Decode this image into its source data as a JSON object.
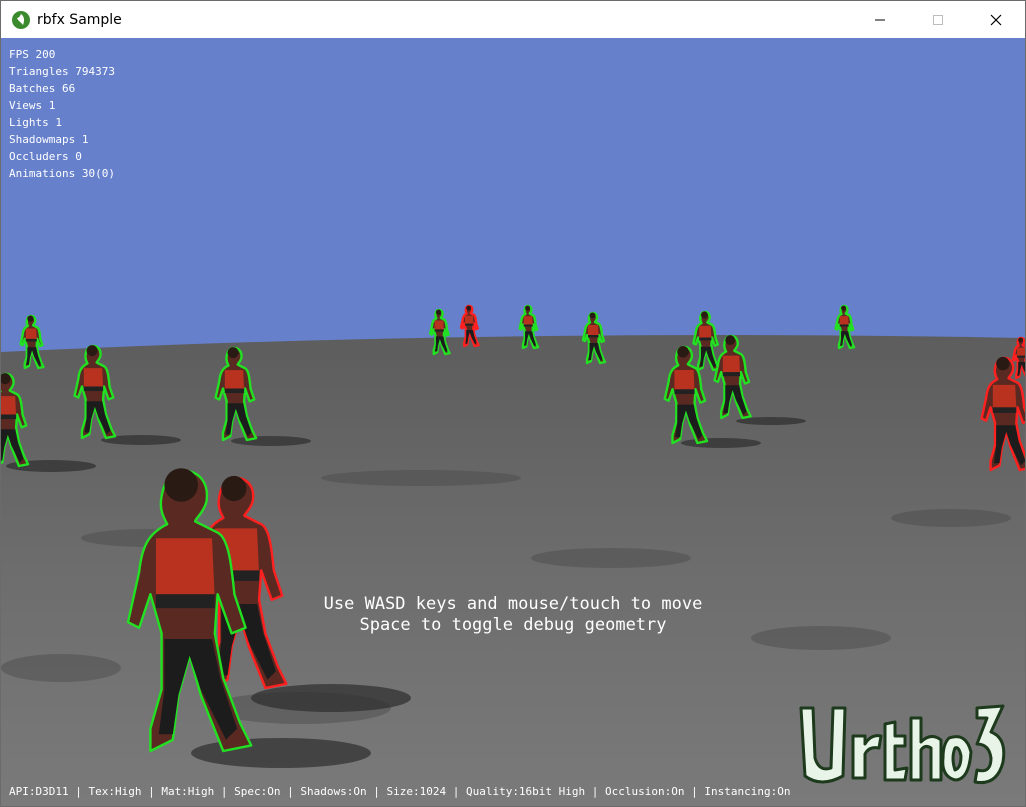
{
  "window": {
    "title": "rbfx Sample",
    "controls": [
      "minimize",
      "maximize",
      "close"
    ]
  },
  "stats": [
    "FPS 200",
    "Triangles 794373",
    "Batches 66",
    "Views 1",
    "Lights 1",
    "Shadowmaps 1",
    "Occluders 0",
    "Animations 30(0)"
  ],
  "instructions": {
    "line1": "Use WASD keys and mouse/touch to move",
    "line2": "Space to toggle debug geometry"
  },
  "status_bar": "API:D3D11 | Tex:High | Mat:High | Spec:On | Shadows:On | Size:1024 | Quality:16bit High | Occlusion:On | Instancing:On",
  "logo": {
    "text": "Urho3D"
  },
  "colors": {
    "sky": "#6680cc",
    "ground": "#6e6e6e",
    "outline_green": "#22e022",
    "outline_red": "#ff2020",
    "logo_fill": "#e8f4e8"
  },
  "icons": [
    "rbfx-app-icon",
    "minimize-icon",
    "maximize-icon",
    "close-icon"
  ]
}
